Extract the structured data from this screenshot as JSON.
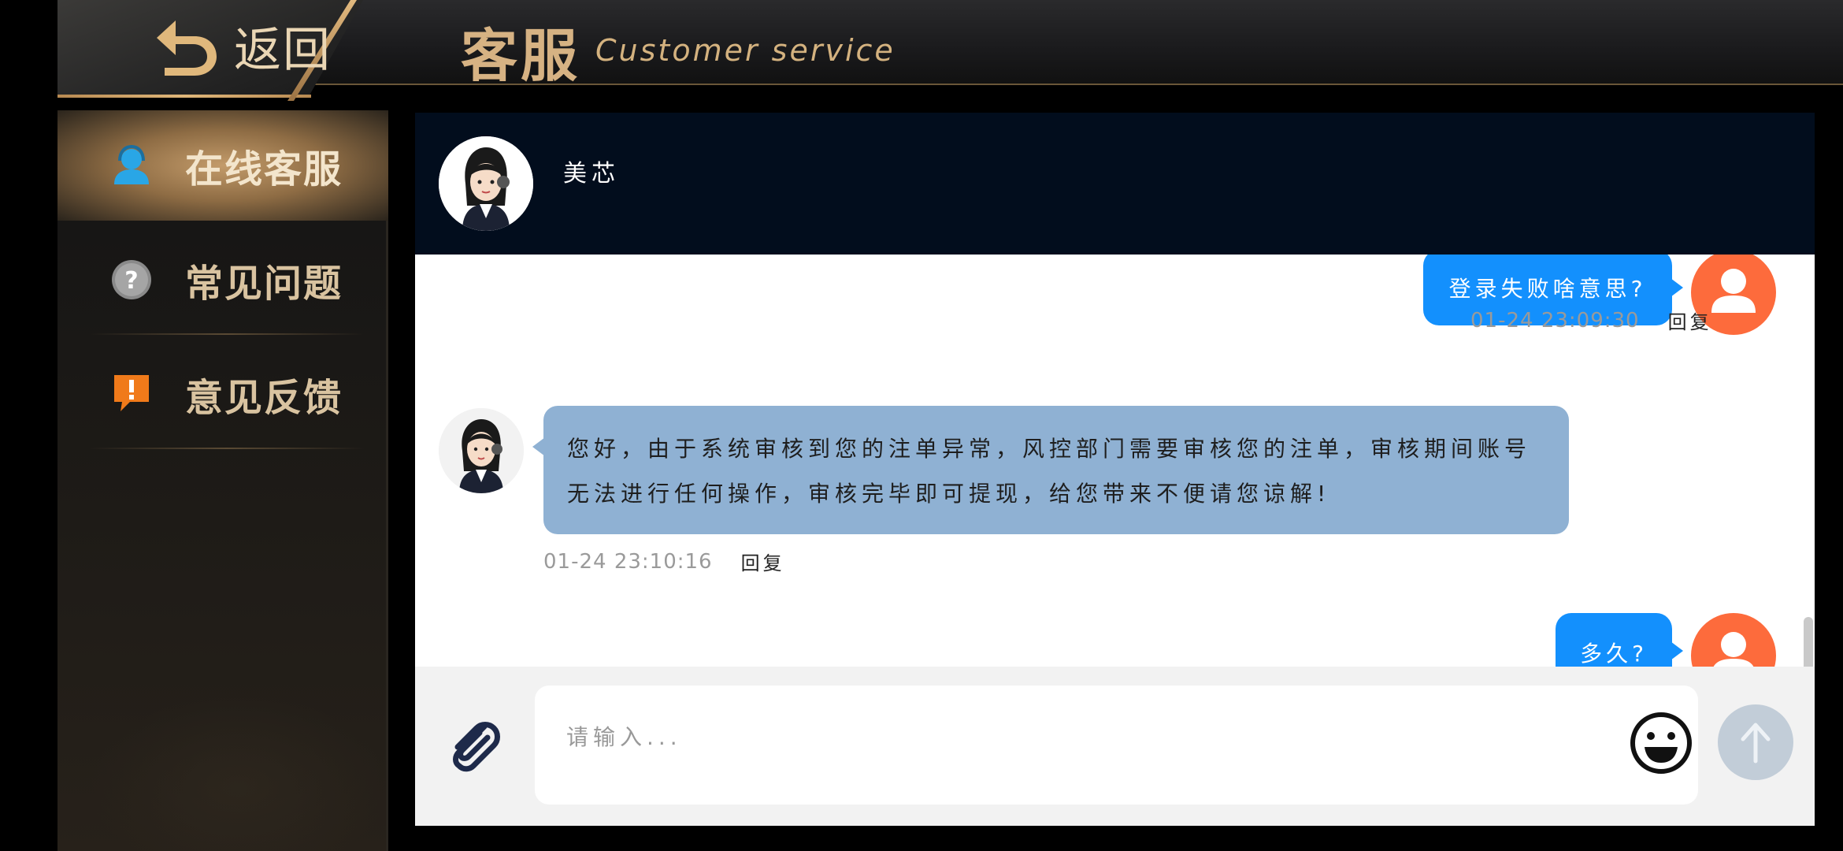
{
  "header": {
    "back_label": "返回",
    "title_cn": "客服",
    "title_en": "Customer service"
  },
  "sidebar": {
    "items": [
      {
        "label": "在线客服",
        "icon": "user-service-icon",
        "active": true
      },
      {
        "label": "常见问题",
        "icon": "question-icon",
        "active": false
      },
      {
        "label": "意见反馈",
        "icon": "feedback-icon",
        "active": false
      }
    ]
  },
  "chat": {
    "agent_name": "美芯",
    "messages": [
      {
        "from": "user",
        "text": "登录失败啥意思?",
        "time": "01-24 23:09:30",
        "reply": "回复"
      },
      {
        "from": "agent",
        "text": "您好，由于系统审核到您的注单异常，风控部门需要审核您的注单，审核期间账号无法进行任何操作，审核完毕即可提现，给您带来不便请您谅解!",
        "time": "01-24 23:10:16",
        "reply": "回复"
      },
      {
        "from": "user",
        "text": "多久?"
      }
    ],
    "input_placeholder": "请输入..."
  },
  "colors": {
    "user_bubble": "#1390fd",
    "agent_bubble": "#8fb1d3",
    "user_avatar": "#fd6b3c",
    "chat_header": "#020d1d",
    "accent_gold": "#d6b283"
  }
}
